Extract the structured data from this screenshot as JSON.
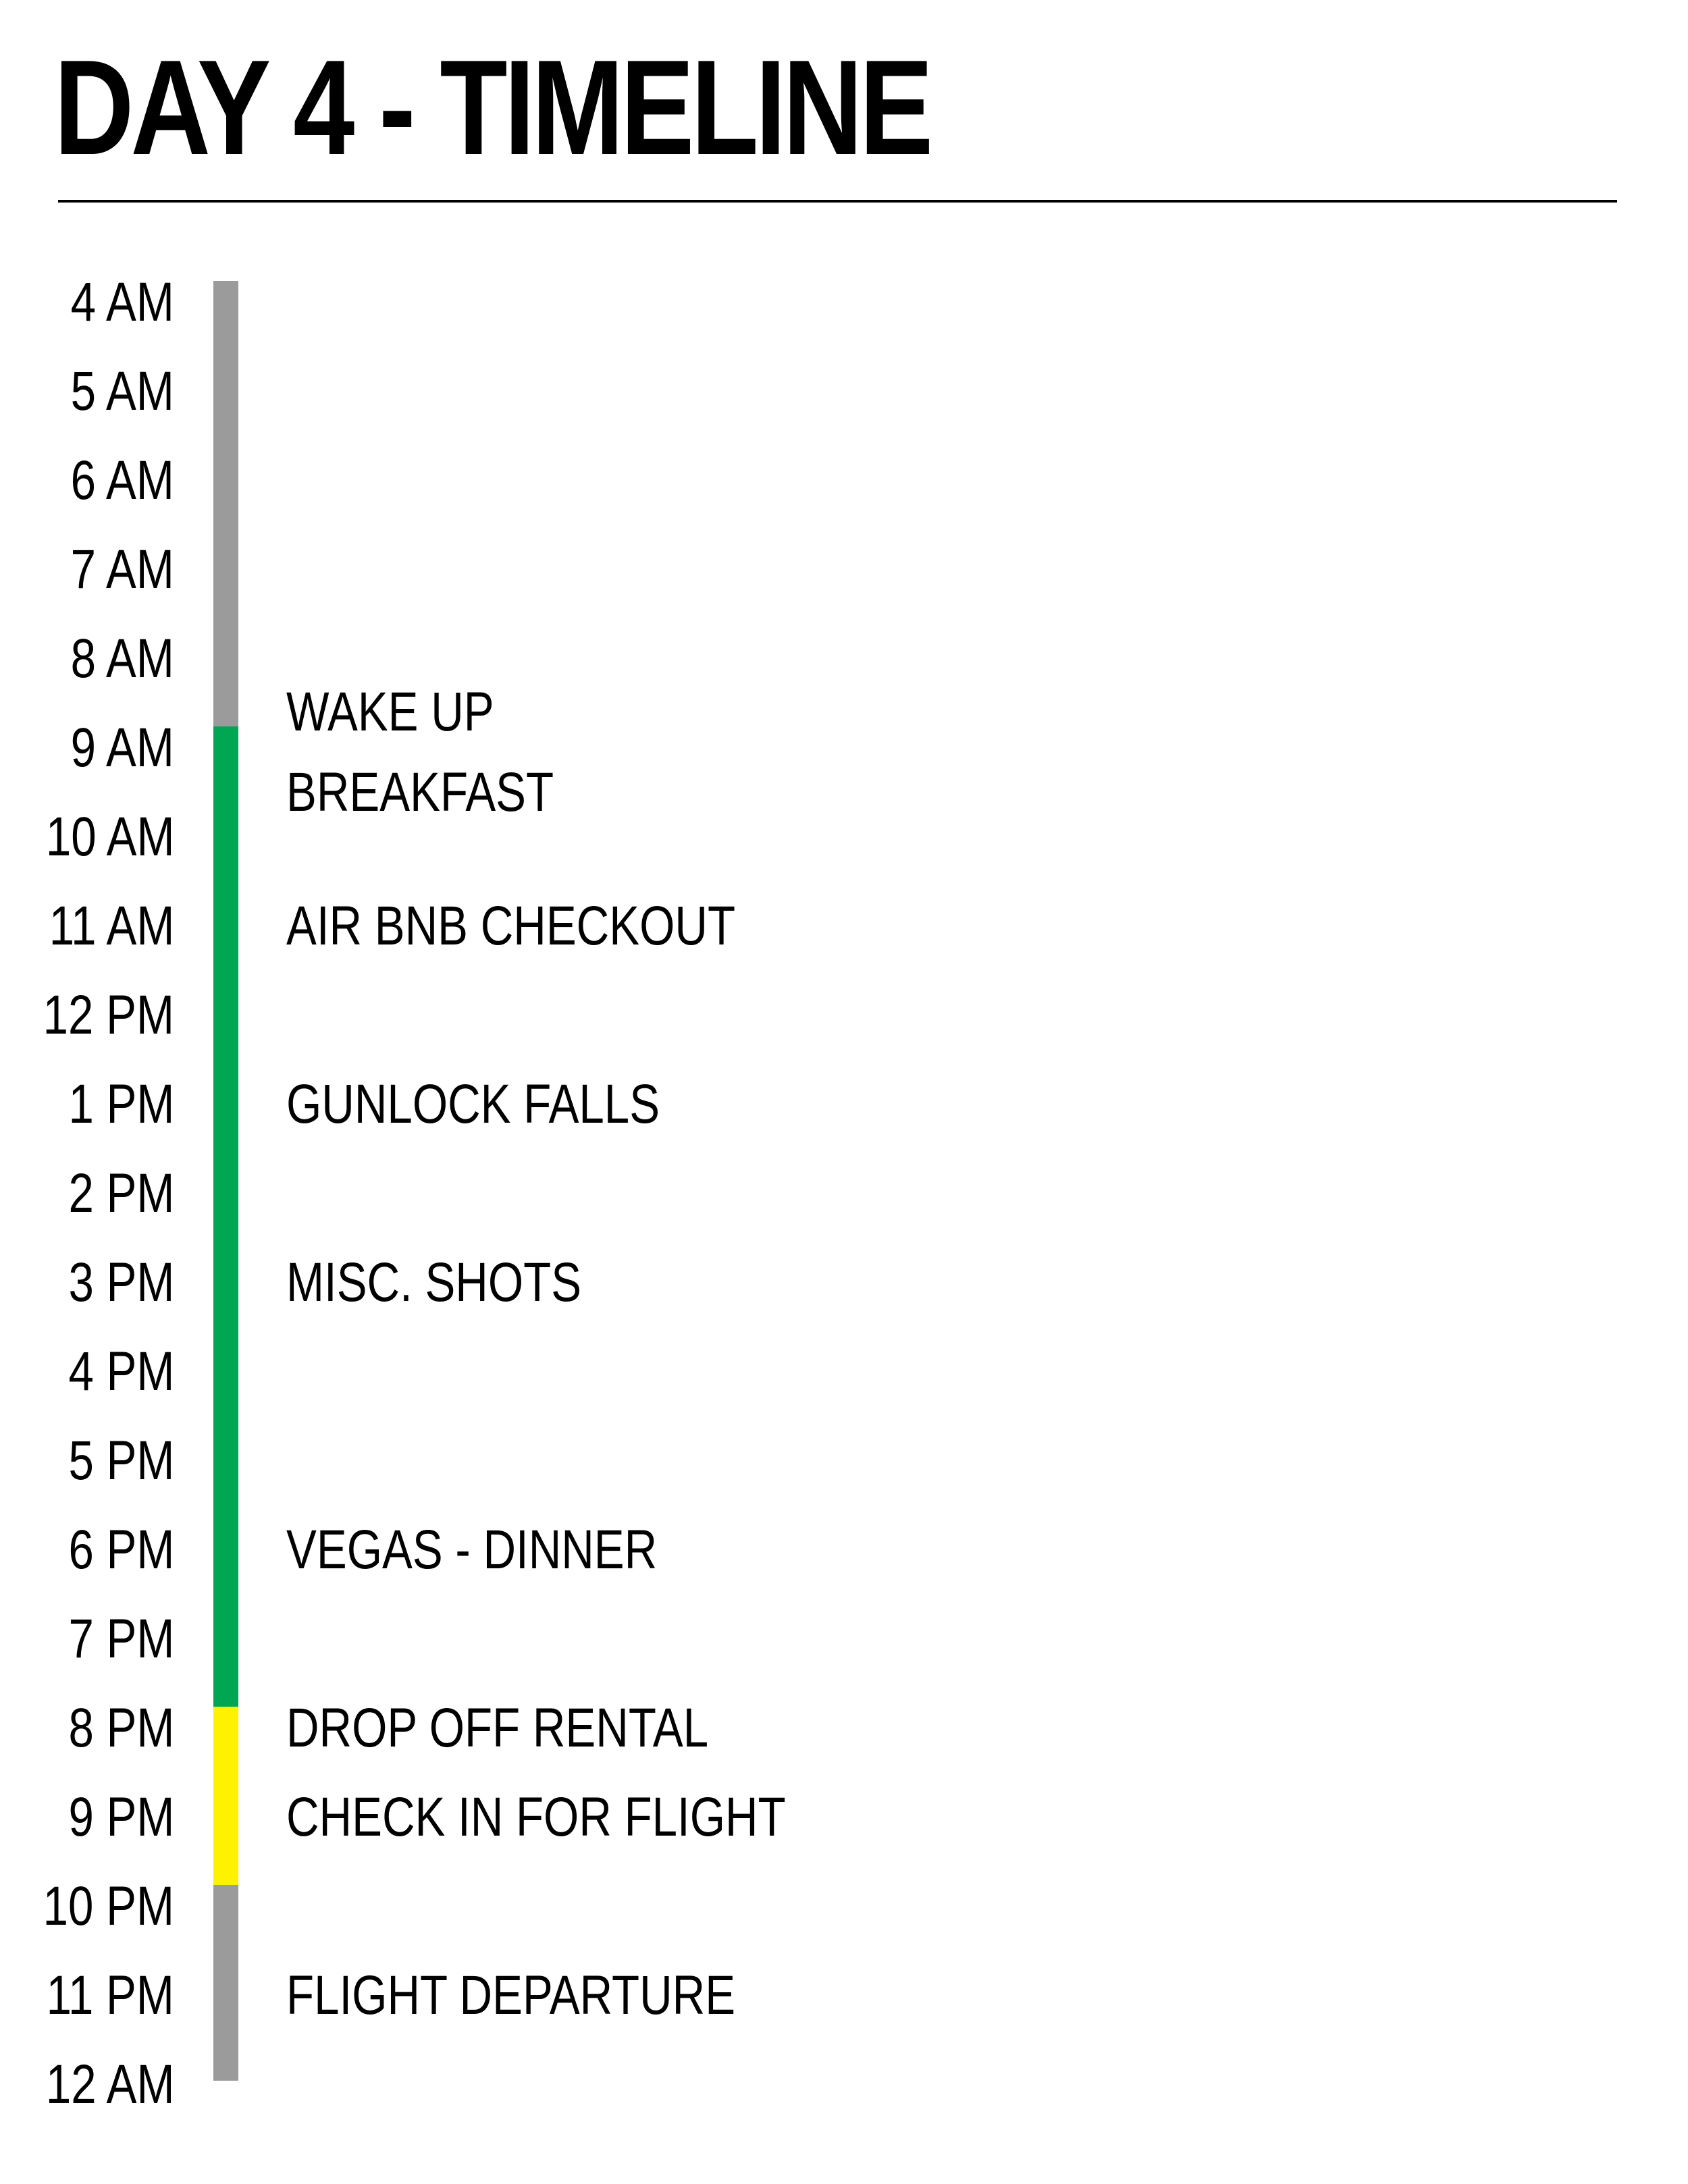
{
  "title": "DAY 4 - TIMELINE",
  "colors": {
    "ink": "#000000",
    "idle": "#9b9b9b",
    "active": "#00a651",
    "travel": "#fff200"
  },
  "hours": [
    "4 AM",
    "5 AM",
    "6 AM",
    "7 AM",
    "8 AM",
    "9 AM",
    "10 AM",
    "11 AM",
    "12 PM",
    "1 PM",
    "2 PM",
    "3 PM",
    "4 PM",
    "5 PM",
    "6 PM",
    "7 PM",
    "8 PM",
    "9 PM",
    "10 PM",
    "11 PM",
    "12 AM"
  ],
  "segments": [
    {
      "from": 0,
      "to": 5,
      "color": "#9b9b9b"
    },
    {
      "from": 5,
      "to": 16,
      "color": "#00a651"
    },
    {
      "from": 16,
      "to": 18,
      "color": "#fff200"
    },
    {
      "from": 18,
      "to": 20.2,
      "color": "#9b9b9b"
    }
  ],
  "events": [
    {
      "label": "WAKE UP",
      "hour": 4.6
    },
    {
      "label": "BREAKFAST",
      "hour": 5.5
    },
    {
      "label": "AIR BNB CHECKOUT",
      "hour": 7
    },
    {
      "label": "GUNLOCK FALLS",
      "hour": 9
    },
    {
      "label": "MISC. SHOTS",
      "hour": 11
    },
    {
      "label": "VEGAS - DINNER",
      "hour": 14
    },
    {
      "label": "DROP OFF RENTAL",
      "hour": 16
    },
    {
      "label": "CHECK IN FOR FLIGHT",
      "hour": 17
    },
    {
      "label": "FLIGHT DEPARTURE",
      "hour": 19
    }
  ]
}
